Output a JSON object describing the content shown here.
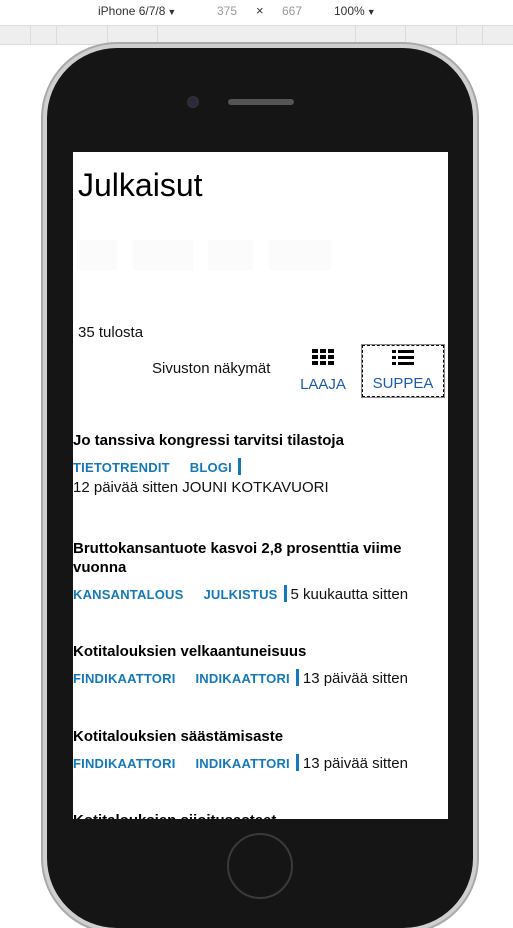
{
  "devtools": {
    "device": "iPhone 6/7/8",
    "width": "375",
    "times": "×",
    "height": "667",
    "zoom": "100%"
  },
  "page": {
    "title": "Julkaisut",
    "result_count": "35 tulosta",
    "views_label": "Sivuston näkymät",
    "view_wide": "LAAJA",
    "view_compact": "SUPPEA"
  },
  "articles": [
    {
      "title": "Jo tanssiva kongressi tarvitsi tilastoja",
      "tags": [
        "TIETOTRENDIT",
        "BLOGI"
      ],
      "date": "12 päivää sitten",
      "author": "JOUNI KOTKAVUORI"
    },
    {
      "title": "Bruttokansantuote kasvoi 2,8 prosenttia viime vuonna",
      "tags": [
        "KANSANTALOUS",
        "JULKISTUS"
      ],
      "date": "5 kuukautta sitten"
    },
    {
      "title": "Kotitalouksien velkaantuneisuus",
      "tags": [
        "FINDIKAATTORI",
        "INDIKAATTORI"
      ],
      "date": "13 päivää sitten"
    },
    {
      "title": "Kotitalouksien säästämisaste",
      "tags": [
        "FINDIKAATTORI",
        "INDIKAATTORI"
      ],
      "date": "13 päivää sitten"
    },
    {
      "title": "Kotitalouksien sijoitusasteet"
    }
  ]
}
